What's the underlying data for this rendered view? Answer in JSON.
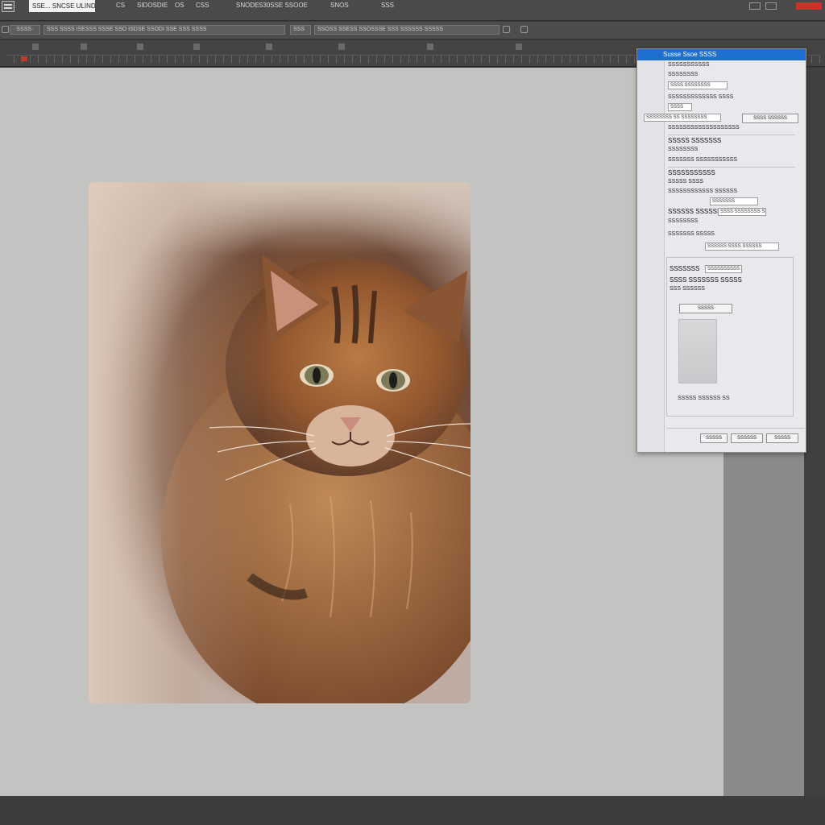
{
  "menubar": {
    "doc_tab": "SSE... SNCSE ULINDS",
    "items": [
      "CS",
      "SIDOSDIE",
      "OS",
      "CSS",
      "SNODE",
      "S30SSE SSOOE",
      "SNOS",
      "SSS"
    ]
  },
  "options_bar": {
    "field1": "· SSSS·",
    "field2": "SSS SSSS ISESSS SSSE SSO ISDSE SSODI SSE SSS SSSS",
    "field3": "SSS",
    "field4": "SSOSS SSESS SSOSSSE SSS SSSSSS SSSSS"
  },
  "dialog": {
    "title": "Susse Ssoe SSSS",
    "rows": [
      "SSSSSSSSSSS",
      "SSSSSSSS",
      "SSSS SSSSSSSS",
      "SSSSSSSSSSSSS SSSS",
      "SSSS",
      "SSSSSSSS SS SSSSSSSS",
      "SSSS SSSSSS",
      "SSSSSSSSSSSSSSSSSSS",
      "SSSSS SSSSSSS",
      "SSSSSSSS",
      "SSSSSSS SSSSSSSSSSS",
      "SSSSSSSSSSS",
      "SSSSS SSSS",
      "SSSSSSSSSSSS SSSSSS",
      "SSSSSSS",
      "SSSSSS SSSSSSSSS",
      "SSSS SSSSSSSS SS",
      "SSSSSSSS",
      "SSSSSSS SSSSS",
      "SSSSSS SSSS SSSSSS",
      "SSSSSSS SSSSS SSS",
      "SSSSSSSSSS",
      "SSSS SSSSSSS SSSSS",
      "SSS SSSSSS",
      "SSSSS SSSSSS SS"
    ],
    "ok_label": "SSSSS",
    "cancel_label": "SSSSS",
    "footer_btn1": "SSSSS",
    "footer_btn2": "SSSSSS"
  },
  "colors": {
    "accent": "#1f6fd1",
    "close": "#d0302a",
    "canvas": "#c3c3c2"
  },
  "icons": [
    "app-icon",
    "window-close-icon",
    "window-minimize-icon",
    "window-maximize-icon"
  ]
}
